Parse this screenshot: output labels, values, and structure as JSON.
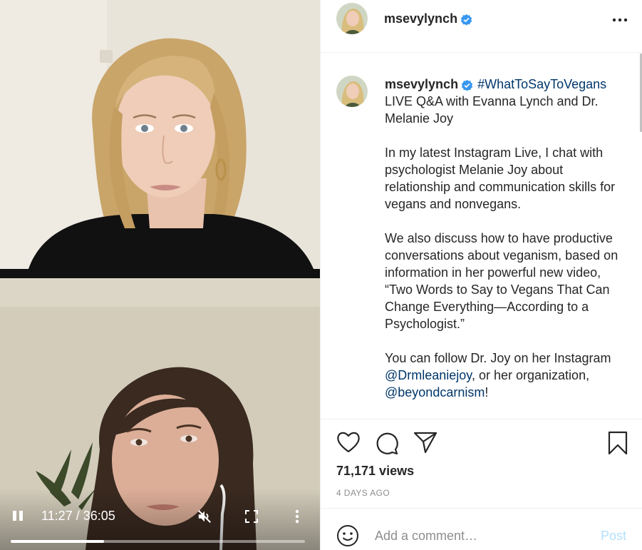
{
  "video": {
    "time": "11:27 / 36:05",
    "progress": 0.317
  },
  "post": {
    "username": "msevylynch",
    "verified": true,
    "caption": {
      "username": "msevylynch",
      "hashtag": "#WhatToSayToVegans",
      "line1": "LIVE Q&A with Evanna Lynch and Dr. Melanie Joy",
      "para2": "In my latest Instagram Live, I chat with psychologist Melanie Joy about relationship and communication skills for vegans and nonvegans.",
      "para3": "We also discuss how to have productive conversations about veganism, based on information in her powerful new video, “Two Words to Say to Vegans That Can Change Everything—According to a Psychologist.”",
      "para4_a": "You can follow Dr. Joy on her Instagram ",
      "para4_mention1": "@Drmleaniejoy",
      "para4_b": ", or her organization, ",
      "para4_mention2": "@beyondcarnism",
      "para4_c": "!"
    },
    "views": "71,171 views",
    "time_ago": "4 DAYS AGO"
  },
  "comment": {
    "placeholder": "Add a comment…",
    "post_label": "Post"
  },
  "colors": {
    "verified": "#3897f0",
    "link": "#00376b",
    "post_button": "#b2dffc"
  }
}
